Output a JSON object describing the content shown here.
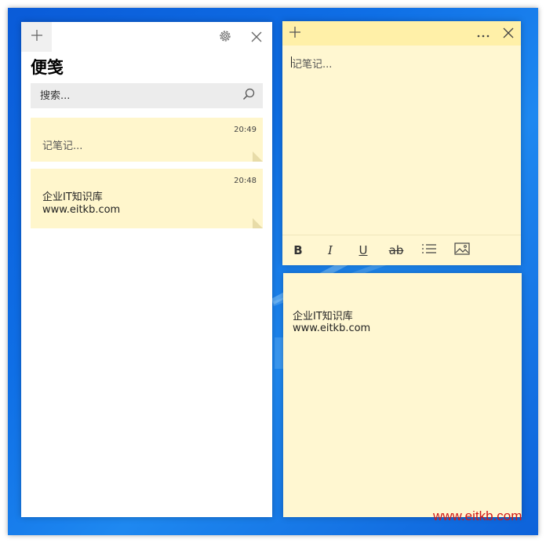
{
  "app": {
    "title": "便笺"
  },
  "search": {
    "placeholder": "搜索..."
  },
  "notes_list": [
    {
      "time": "20:49",
      "lines": [
        "记笔记..."
      ]
    },
    {
      "time": "20:48",
      "lines": [
        "企业IT知识库",
        "www.eitkb.com"
      ]
    }
  ],
  "editor": {
    "placeholder": "记笔记..."
  },
  "note2": {
    "lines": [
      "企业IT知识库",
      "www.eitkb.com"
    ]
  },
  "format_toolbar": {
    "bold": "B",
    "italic": "I",
    "underline": "U",
    "strike": "ab"
  },
  "icons": {
    "add": "plus-icon",
    "settings": "gear-icon",
    "close": "close-icon",
    "search": "search-icon",
    "more": "more-icon",
    "list": "list-icon",
    "image": "image-icon"
  },
  "colors": {
    "note_yellow": "#fff7d1",
    "note_header": "#fff0a8",
    "desktop_blue": "#0f6fe6",
    "watermark": "#d11818"
  },
  "watermark": "www.eitkb.com"
}
